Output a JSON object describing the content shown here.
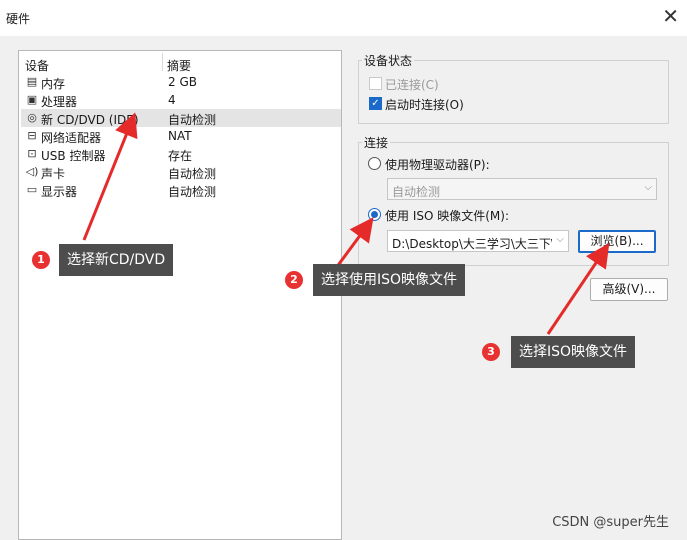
{
  "window": {
    "title": "硬件",
    "close_icon": "close-icon"
  },
  "devices": {
    "columns": {
      "device": "设备",
      "summary": "摘要"
    },
    "rows": [
      {
        "icon": "memory-icon",
        "name": "内存",
        "summary": "2 GB",
        "selected": false
      },
      {
        "icon": "cpu-icon",
        "name": "处理器",
        "summary": "4",
        "selected": false
      },
      {
        "icon": "cd-dvd-icon",
        "name": "新 CD/DVD (IDE)",
        "summary": "自动检测",
        "selected": true
      },
      {
        "icon": "network-icon",
        "name": "网络适配器",
        "summary": "NAT",
        "selected": false
      },
      {
        "icon": "usb-icon",
        "name": "USB 控制器",
        "summary": "存在",
        "selected": false
      },
      {
        "icon": "sound-icon",
        "name": "声卡",
        "summary": "自动检测",
        "selected": false
      },
      {
        "icon": "display-icon",
        "name": "显示器",
        "summary": "自动检测",
        "selected": false
      }
    ]
  },
  "device_status": {
    "label": "设备状态",
    "connected": {
      "label": "已连接(C)",
      "checked": false,
      "enabled": false
    },
    "connect_on_power_on": {
      "label": "启动时连接(O)",
      "checked": true,
      "enabled": true
    }
  },
  "connection": {
    "label": "连接",
    "physical_drive": {
      "label": "使用物理驱动器(P):",
      "selected": false
    },
    "physical_drive_select": {
      "value": "自动检测"
    },
    "iso_image": {
      "label": "使用 ISO 映像文件(M):",
      "selected": true
    },
    "iso_path": {
      "value": "D:\\Desktop\\大三学习\\大三下\\"
    },
    "browse_button": "浏览(B)..."
  },
  "advanced_button": "高级(V)...",
  "annotations": [
    {
      "number": "1",
      "text": "选择新CD/DVD"
    },
    {
      "number": "2",
      "text": "选择使用ISO映像文件"
    },
    {
      "number": "3",
      "text": "选择ISO映像文件"
    }
  ],
  "watermark": "CSDN @super先生",
  "colors": {
    "accent": "#1b6ac9",
    "badge": "#e83232",
    "arrow": "#e52a2a",
    "callout_bg": "#4d4d4d"
  }
}
